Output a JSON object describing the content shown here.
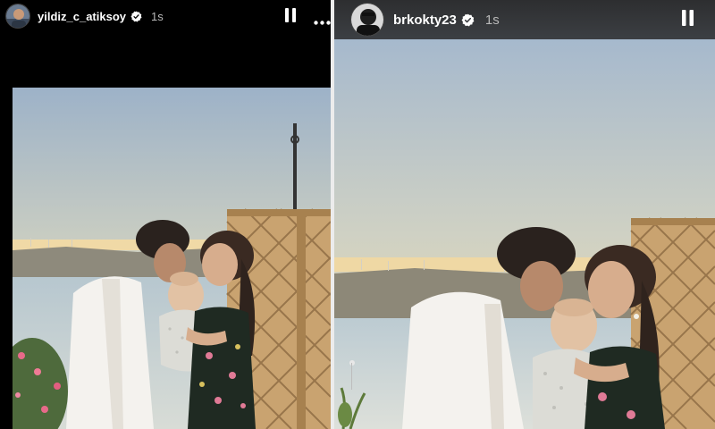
{
  "stories": [
    {
      "username": "yildiz_c_atiksoy",
      "time": "1s",
      "verified": true,
      "icons": [
        "profile-avatar",
        "verified-badge",
        "pause-icon",
        "more-icon"
      ]
    },
    {
      "username": "brkokty23",
      "time": "1s",
      "verified": true,
      "icons": [
        "profile-avatar",
        "verified-badge",
        "pause-icon"
      ]
    }
  ],
  "colors": {
    "header_dark": "#000000",
    "header_gray": "#3a3c40",
    "verified_badge": "#ffffff",
    "sky_top": "#9fb3c9",
    "sky_horizon": "#f2d8a0"
  }
}
